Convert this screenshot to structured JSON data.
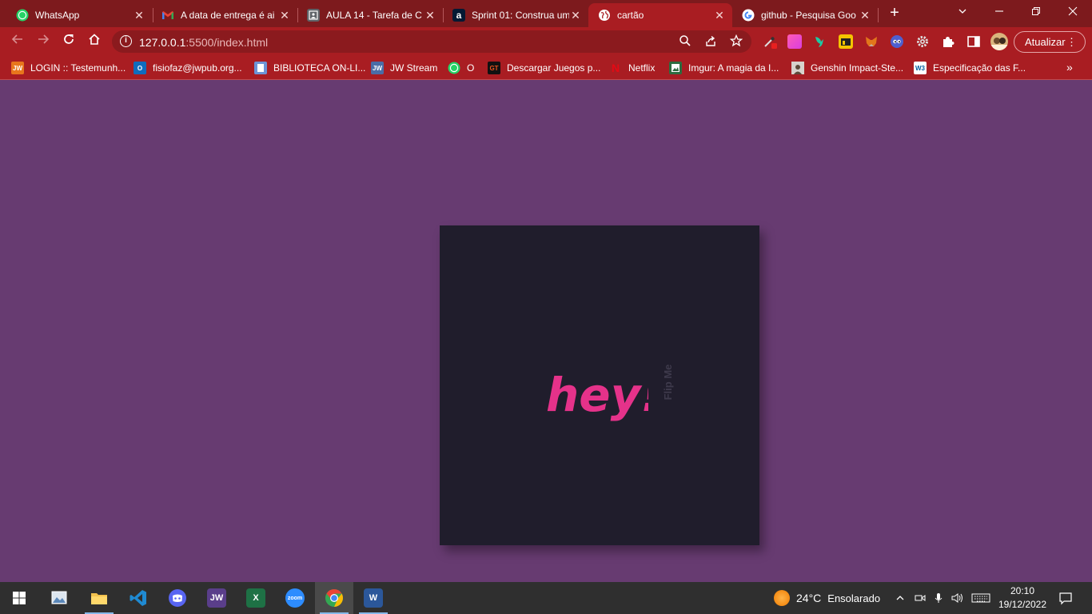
{
  "browser": {
    "tabs": [
      {
        "title": "WhatsApp",
        "icon": "whatsapp-icon",
        "color": "#25d366"
      },
      {
        "title": "A data de entrega é ai",
        "icon": "gmail-icon",
        "color": "#ea4335"
      },
      {
        "title": "AULA 14 - Tarefa de C",
        "icon": "classroom-icon",
        "color": "#5f6368"
      },
      {
        "title": "Sprint 01: Construa um",
        "icon": "alura-icon",
        "color": "#051933"
      },
      {
        "title": "cartão",
        "icon": "globe-icon",
        "color": "#ffffff"
      },
      {
        "title": "github - Pesquisa Goo",
        "icon": "google-icon",
        "color": "#4285f4"
      }
    ],
    "url_host": "127.0.0.1",
    "url_path": ":5500/index.html",
    "update_label": "Atualizar",
    "theme_color": "#a91d22"
  },
  "bookmarks": [
    {
      "label": "LOGIN :: Testemunh...",
      "icon": "jw-icon",
      "color": "#e8761c",
      "mark": "JW"
    },
    {
      "label": "fisiofaz@jwpub.org...",
      "icon": "outlook-icon",
      "color": "#0f6cbd",
      "mark": "O"
    },
    {
      "label": "BIBLIOTECA ON-LI...",
      "icon": "library-icon",
      "color": "#6d94d6",
      "mark": ""
    },
    {
      "label": "JW Stream",
      "icon": "jw-stream-icon",
      "color": "#4a6da7",
      "mark": "JW"
    },
    {
      "label": "O",
      "icon": "whatsapp-icon",
      "color": "#25d366",
      "mark": ""
    },
    {
      "label": "Descargar Juegos p...",
      "icon": "games-icon",
      "color": "#111111",
      "mark": "GT"
    },
    {
      "label": "Netflix",
      "icon": "netflix-icon",
      "color": "#e50914",
      "mark": "N"
    },
    {
      "label": "Imgur: A magia da I...",
      "icon": "imgur-icon",
      "color": "#2d6b3f",
      "mark": ""
    },
    {
      "label": "Genshin Impact-Ste...",
      "icon": "genshin-icon",
      "color": "#8c8c8c",
      "mark": ""
    },
    {
      "label": "Especificação das F...",
      "icon": "w3c-icon",
      "color": "#ffffff",
      "mark": "W3"
    }
  ],
  "card": {
    "greeting": "hey!",
    "hint": "Flip Me",
    "greeting_color": "#e5328a",
    "background": "#201d2c",
    "page_background": "#673b71"
  },
  "taskbar": {
    "apps": [
      {
        "name": "Photos",
        "icon": "photos-icon",
        "color": "#5b87b8",
        "mark": ""
      },
      {
        "name": "File Explorer",
        "icon": "folder-icon",
        "color": "#f2c14e",
        "mark": ""
      },
      {
        "name": "Visual Studio Code",
        "icon": "vscode-icon",
        "color": "#1f8ad2",
        "mark": ""
      },
      {
        "name": "Discord",
        "icon": "discord-icon",
        "color": "#5865f2",
        "mark": ""
      },
      {
        "name": "JW Library",
        "icon": "jw-library-icon",
        "color": "#5a3e8a",
        "mark": "JW"
      },
      {
        "name": "Excel",
        "icon": "excel-icon",
        "color": "#1e7145",
        "mark": "X"
      },
      {
        "name": "Zoom",
        "icon": "zoom-icon",
        "color": "#2d8cff",
        "mark": "zoom"
      },
      {
        "name": "Google Chrome",
        "icon": "chrome-icon",
        "color": "#34a853",
        "mark": ""
      },
      {
        "name": "Word",
        "icon": "word-icon",
        "color": "#2b579a",
        "mark": "W"
      }
    ],
    "weather_temp": "24°C",
    "weather_desc": "Ensolarado",
    "time": "20:10",
    "date": "19/12/2022"
  }
}
